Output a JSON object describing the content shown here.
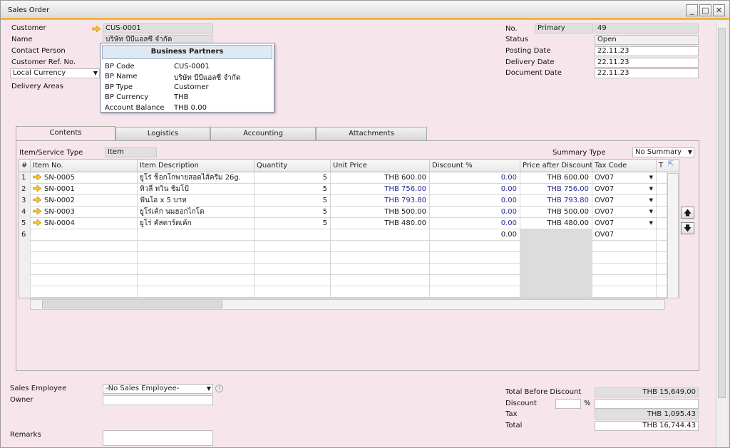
{
  "window": {
    "title": "Sales Order",
    "minimize": "_",
    "maximize": "□",
    "close": "✕"
  },
  "header_left": {
    "customer_label": "Customer",
    "customer_value": "CUS-0001",
    "name_label": "Name",
    "name_value": "บริษัท บีบีแอลซี จำกัด",
    "contact_label": "Contact Person",
    "ref_label": "Customer Ref. No.",
    "currency_value": "Local Currency",
    "delivery_label": "Delivery Areas"
  },
  "tooltip": {
    "title": "Business Partners",
    "rows": [
      {
        "k": "BP Code",
        "v": "CUS-0001"
      },
      {
        "k": "BP Name",
        "v": "บริษัท บีบีแอลซี จำกัด"
      },
      {
        "k": "BP Type",
        "v": "Customer"
      },
      {
        "k": "BP Currency",
        "v": "THB"
      },
      {
        "k": "Account Balance",
        "v": "THB 0.00"
      }
    ]
  },
  "header_right": {
    "no_label": "No.",
    "series_value": "Primary",
    "no_value": "49",
    "status_label": "Status",
    "status_value": "Open",
    "posting_label": "Posting Date",
    "posting_value": "22.11.23",
    "delivery_label": "Delivery Date",
    "delivery_value": "22.11.23",
    "document_label": "Document Date",
    "document_value": "22.11.23"
  },
  "tabs": [
    "Contents",
    "Logistics",
    "Accounting",
    "Attachments"
  ],
  "contents": {
    "item_type_label": "Item/Service Type",
    "item_type_value": "Item",
    "summary_label": "Summary Type",
    "summary_value": "No Summary",
    "columns": [
      "#",
      "Item No.",
      "Item Description",
      "Quantity",
      "Unit Price",
      "Discount %",
      "Price after Discount",
      "Tax Code",
      "T"
    ],
    "rows": [
      {
        "n": "1",
        "item": "SN-0005",
        "desc": "ยูโร่ ช็อกโกพายสอดไส้ครีม 26g.",
        "qty": "5",
        "price": "THB 600.00",
        "disc": "0.00",
        "after": "THB 600.00",
        "tax": "OV07",
        "blue": false
      },
      {
        "n": "2",
        "item": "SN-0001",
        "desc": "ทิวลี่ ทวิน ชิมโป้",
        "qty": "5",
        "price": "THB 756.00",
        "disc": "0.00",
        "after": "THB 756.00",
        "tax": "OV07",
        "blue": true
      },
      {
        "n": "3",
        "item": "SN-0002",
        "desc": "ฟันโอ x 5 บาท",
        "qty": "5",
        "price": "THB 793.80",
        "disc": "0.00",
        "after": "THB 793.80",
        "tax": "OV07",
        "blue": true
      },
      {
        "n": "4",
        "item": "SN-0003",
        "desc": "ยูโร่เค้ก นมฮอกไกโด",
        "qty": "5",
        "price": "THB 500.00",
        "disc": "0.00",
        "after": "THB 500.00",
        "tax": "OV07",
        "blue": false
      },
      {
        "n": "5",
        "item": "SN-0004",
        "desc": "ยูโร่ คัสตาร์ดเค้ก",
        "qty": "5",
        "price": "THB 480.00",
        "disc": "0.00",
        "after": "THB 480.00",
        "tax": "OV07",
        "blue": false
      },
      {
        "n": "6",
        "item": "",
        "desc": "",
        "qty": "",
        "price": "",
        "disc": "0.00",
        "after": "",
        "tax": "OV07",
        "blue": false
      }
    ]
  },
  "footer_left": {
    "employee_label": "Sales Employee",
    "employee_value": "-No Sales Employee-",
    "owner_label": "Owner",
    "remarks_label": "Remarks"
  },
  "totals": {
    "before_label": "Total Before Discount",
    "before_value": "THB 15,649.00",
    "discount_label": "Discount",
    "percent": "%",
    "tax_label": "Tax",
    "tax_value": "THB 1,095.43",
    "total_label": "Total",
    "total_value": "THB 16,744.43"
  },
  "colors": {
    "accent": "#f4b33a",
    "background": "#f6e6ec",
    "link_blue": "#2a2a9c"
  }
}
